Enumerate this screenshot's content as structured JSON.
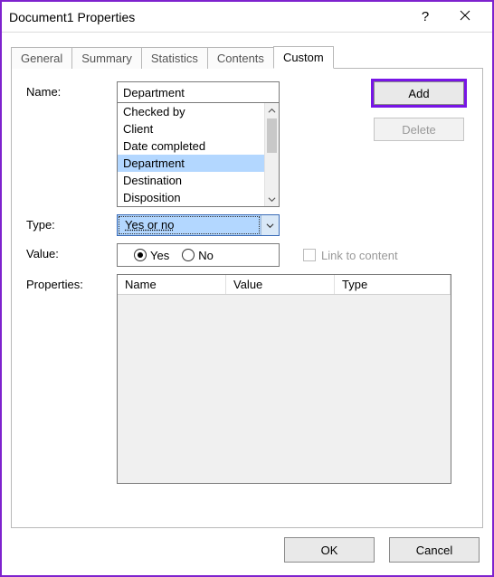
{
  "window": {
    "title": "Document1 Properties",
    "help_glyph": "?",
    "close_glyph": "✕"
  },
  "tabs": {
    "items": [
      {
        "label": "General"
      },
      {
        "label": "Summary"
      },
      {
        "label": "Statistics"
      },
      {
        "label": "Contents"
      },
      {
        "label": "Custom"
      }
    ],
    "active_index": 4
  },
  "labels": {
    "name": "Name:",
    "type": "Type:",
    "value": "Value:",
    "properties": "Properties:"
  },
  "name": {
    "value": "Department",
    "options": [
      "Checked by",
      "Client",
      "Date completed",
      "Department",
      "Destination",
      "Disposition"
    ],
    "selected_index": 3
  },
  "buttons": {
    "add": "Add",
    "delete": "Delete",
    "ok": "OK",
    "cancel": "Cancel"
  },
  "type": {
    "value": "Yes or no"
  },
  "value_radio": {
    "options": [
      "Yes",
      "No"
    ],
    "selected_index": 0
  },
  "link_to_content": {
    "label": "Link to content",
    "checked": false,
    "enabled": false
  },
  "props_table": {
    "columns": [
      "Name",
      "Value",
      "Type"
    ],
    "rows": []
  },
  "highlight_color": "#7815e6"
}
